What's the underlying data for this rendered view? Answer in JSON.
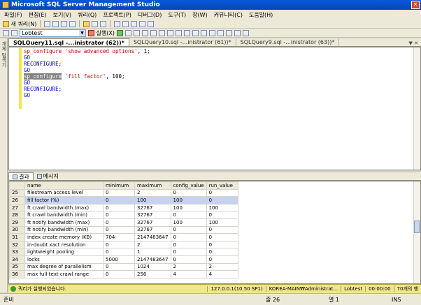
{
  "window": {
    "title": "Microsoft SQL Server Management Studio"
  },
  "menu": [
    "파일(F)",
    "편집(E)",
    "보기(V)",
    "쿼리(Q)",
    "프로젝트(P)",
    "디버그(D)",
    "도구(T)",
    "창(W)",
    "커뮤니티(C)",
    "도움말(H)"
  ],
  "toolbar": {
    "new_query_label": "새 쿼리(N)",
    "database": "Lobtest",
    "execute_label": "실행(X)"
  },
  "side_panel_label": "개체 탐색기",
  "tabs": [
    {
      "label": "SQLQuery11.sql -...inistrator (62))*",
      "active": true
    },
    {
      "label": "SQLQuery10.sql -...inistrator (61))*",
      "active": false
    },
    {
      "label": "SQLQuery9.sql -...inistrator (63))*",
      "active": false
    }
  ],
  "editor": {
    "lines": [
      [
        {
          "t": "sp_configure ",
          "c": "k-red"
        },
        {
          "t": "'show advanced options'",
          "c": "k-red"
        },
        {
          "t": ", 1;",
          "c": ""
        }
      ],
      [
        {
          "t": "GO",
          "c": "k-blue"
        }
      ],
      [
        {
          "t": "RECONFIGURE",
          "c": "k-blue"
        },
        {
          "t": ";",
          "c": ""
        }
      ],
      [
        {
          "t": "GO",
          "c": "k-blue"
        }
      ],
      [
        {
          "t": "sp_configure",
          "c": "hl"
        },
        {
          "t": " ",
          "c": ""
        },
        {
          "t": "'fill factor'",
          "c": "k-red"
        },
        {
          "t": ", 100;",
          "c": ""
        }
      ],
      [
        {
          "t": "GO",
          "c": "k-blue"
        }
      ],
      [
        {
          "t": "RECONFIGURE",
          "c": "k-blue"
        },
        {
          "t": ";",
          "c": ""
        }
      ],
      [
        {
          "t": "GO",
          "c": "k-blue"
        }
      ]
    ]
  },
  "results_tabs": {
    "results": "결과",
    "messages": "메시지"
  },
  "grid": {
    "columns": [
      "name",
      "minimum",
      "maximum",
      "config_value",
      "run_value"
    ],
    "selected_row": "26",
    "rows": [
      [
        "25",
        "filestream access level",
        "0",
        "2",
        "0",
        "0"
      ],
      [
        "26",
        "fill factor (%)",
        "0",
        "100",
        "100",
        "0"
      ],
      [
        "27",
        "ft crawl bandwidth (max)",
        "0",
        "32767",
        "100",
        "100"
      ],
      [
        "28",
        "ft crawl bandwidth (min)",
        "0",
        "32767",
        "0",
        "0"
      ],
      [
        "29",
        "ft notify bandwidth (max)",
        "0",
        "32767",
        "100",
        "100"
      ],
      [
        "30",
        "ft notify bandwidth (min)",
        "0",
        "32767",
        "0",
        "0"
      ],
      [
        "31",
        "index create memory (KB)",
        "704",
        "2147483647",
        "0",
        "0"
      ],
      [
        "32",
        "in-doubt xact resolution",
        "0",
        "2",
        "0",
        "0"
      ],
      [
        "33",
        "lightweight pooling",
        "0",
        "1",
        "0",
        "0"
      ],
      [
        "34",
        "locks",
        "5000",
        "2147483647",
        "0",
        "0"
      ],
      [
        "35",
        "max degree of parallelism",
        "0",
        "1024",
        "2",
        "2"
      ],
      [
        "36",
        "max full-text crawl range",
        "0",
        "256",
        "4",
        "4"
      ]
    ]
  },
  "query_status": {
    "message": "쿼리가 실행되었습니다.",
    "server": "127.0.0.1(10.50 SP1)",
    "login": "KOREA-MAIN₩Administrat...",
    "database": "Lobtest",
    "elapsed": "00:00:00",
    "rows": "70개의 행"
  },
  "statusbar": {
    "ready": "준비",
    "line": "줄 26",
    "col": "열 1",
    "mode": "INS"
  }
}
